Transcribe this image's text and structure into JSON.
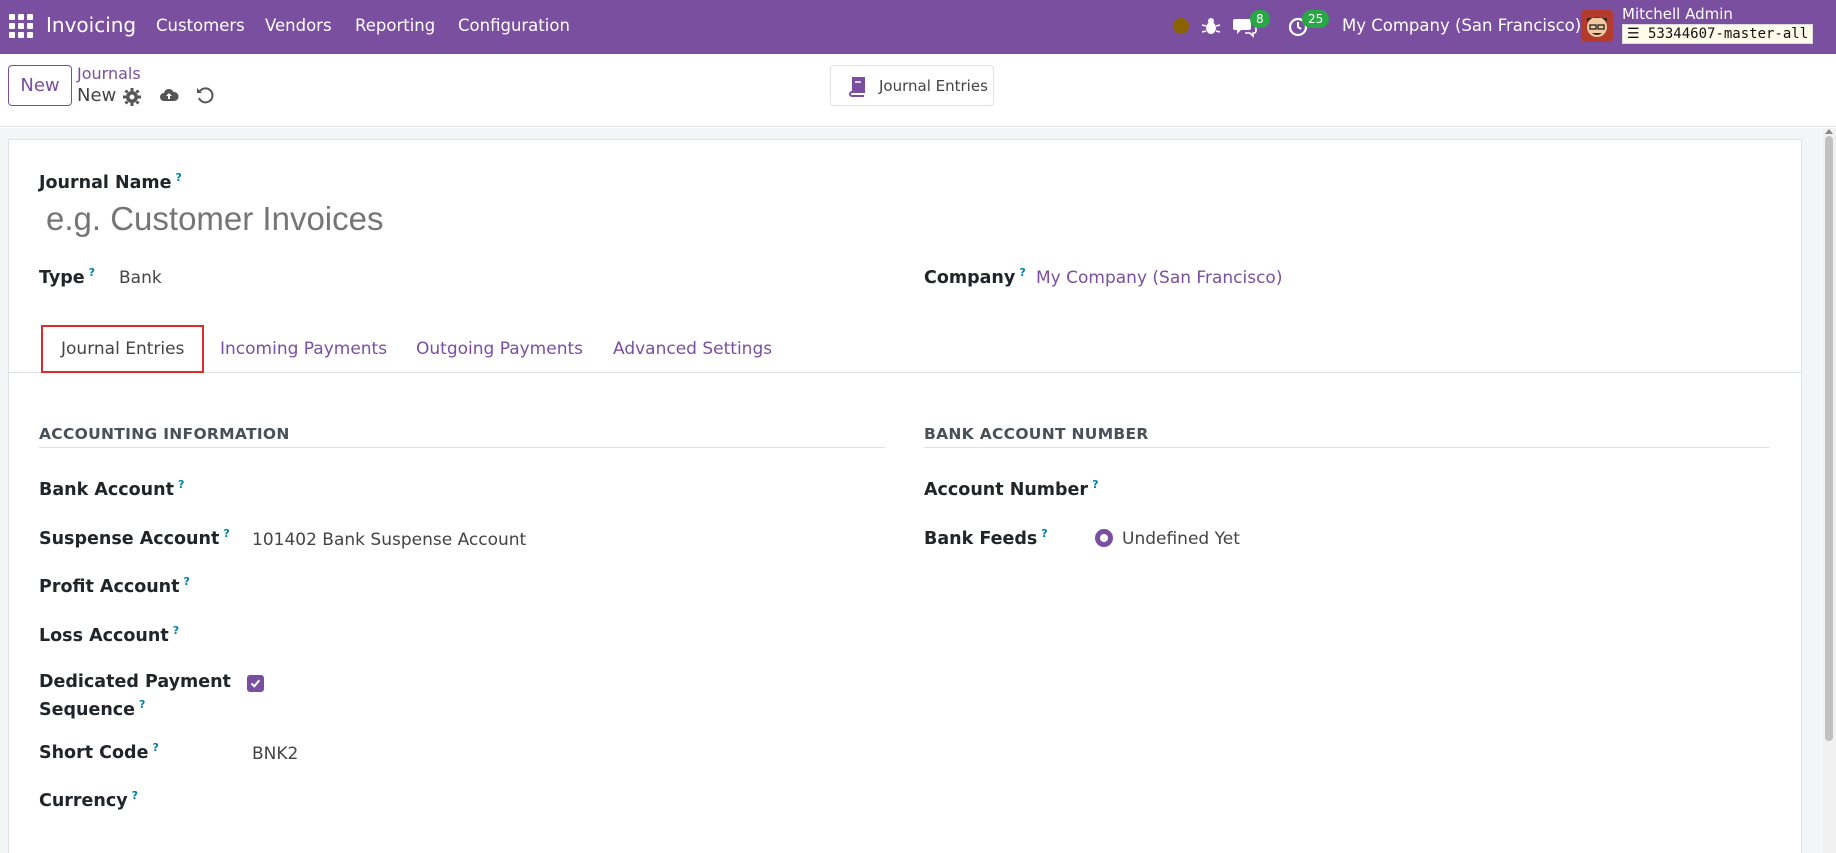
{
  "navbar": {
    "app_name": "Invoicing",
    "menus": [
      "Customers",
      "Vendors",
      "Reporting",
      "Configuration"
    ],
    "messages_count": "8",
    "activities_count": "25",
    "company": "My Company (San Francisco)",
    "user_name": "Mitchell Admin",
    "database": "53344607-master-all"
  },
  "control_panel": {
    "new_label": "New",
    "breadcrumb_parent": "Journals",
    "breadcrumb_current": "New",
    "smart_button_label": "Journal Entries"
  },
  "form": {
    "journal_name_label": "Journal Name",
    "journal_name_placeholder": "e.g. Customer Invoices",
    "type_label": "Type",
    "type_value": "Bank",
    "company_label": "Company",
    "company_value": "My Company (San Francisco)",
    "help_mark": "?"
  },
  "tabs": [
    "Journal Entries",
    "Incoming Payments",
    "Outgoing Payments",
    "Advanced Settings"
  ],
  "active_tab": "Journal Entries",
  "accounting": {
    "title": "ACCOUNTING INFORMATION",
    "bank_account_label": "Bank Account",
    "suspense_account_label": "Suspense Account",
    "suspense_account_value": "101402 Bank Suspense Account",
    "profit_account_label": "Profit Account",
    "loss_account_label": "Loss Account",
    "dedicated_payment_label_1": "Dedicated Payment",
    "dedicated_payment_label_2": "Sequence",
    "dedicated_payment_checked": true,
    "short_code_label": "Short Code",
    "short_code_value": "BNK2",
    "currency_label": "Currency"
  },
  "bank": {
    "title": "BANK ACCOUNT NUMBER",
    "account_number_label": "Account Number",
    "bank_feeds_label": "Bank Feeds",
    "bank_feeds_value": "Undefined Yet"
  },
  "colors": {
    "brand": "#7b4fa0",
    "badge": "#28a745",
    "active_tab_outline": "#e02b2b",
    "help": "#0180a5"
  }
}
